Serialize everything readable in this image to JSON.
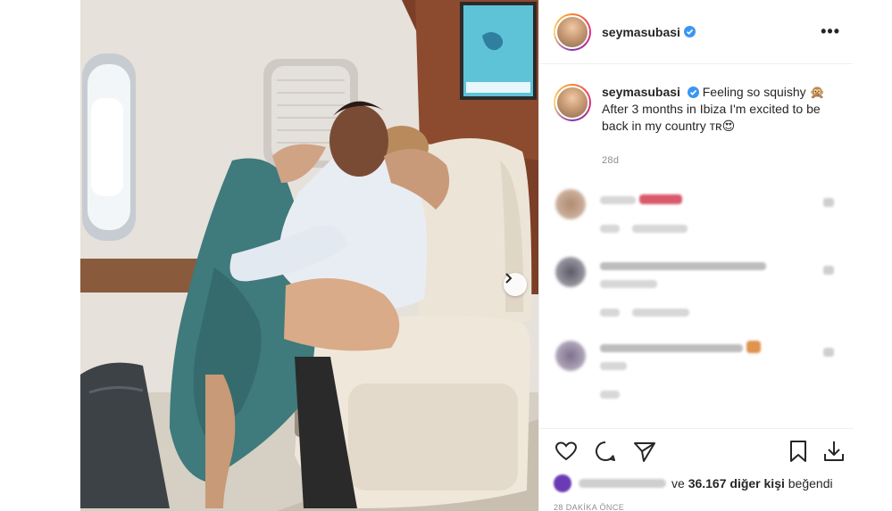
{
  "post": {
    "username": "seymasubasi",
    "caption_username": "seymasubasi",
    "caption_text": "Feeling so squishy 🙊 After 3 months in Ibiza I'm excited to be back in my country ᴛʀ😍",
    "time_ago": "28d",
    "more_label": "•••"
  },
  "likes": {
    "prefix": "ve",
    "count": "36.167",
    "suffix_bold": "diğer kişi",
    "suffix": "beğendi"
  },
  "posted_label": "28 DAKİKA ÖNCE",
  "icons": {
    "like": "heart-icon",
    "comment": "comment-icon",
    "share": "send-icon",
    "save": "bookmark-icon",
    "download": "download-icon",
    "next": "chevron-right-icon",
    "verified": "verified-badge-icon"
  },
  "colors": {
    "verified": "#3897f0",
    "text": "#262626",
    "muted": "#8e8e8e"
  }
}
